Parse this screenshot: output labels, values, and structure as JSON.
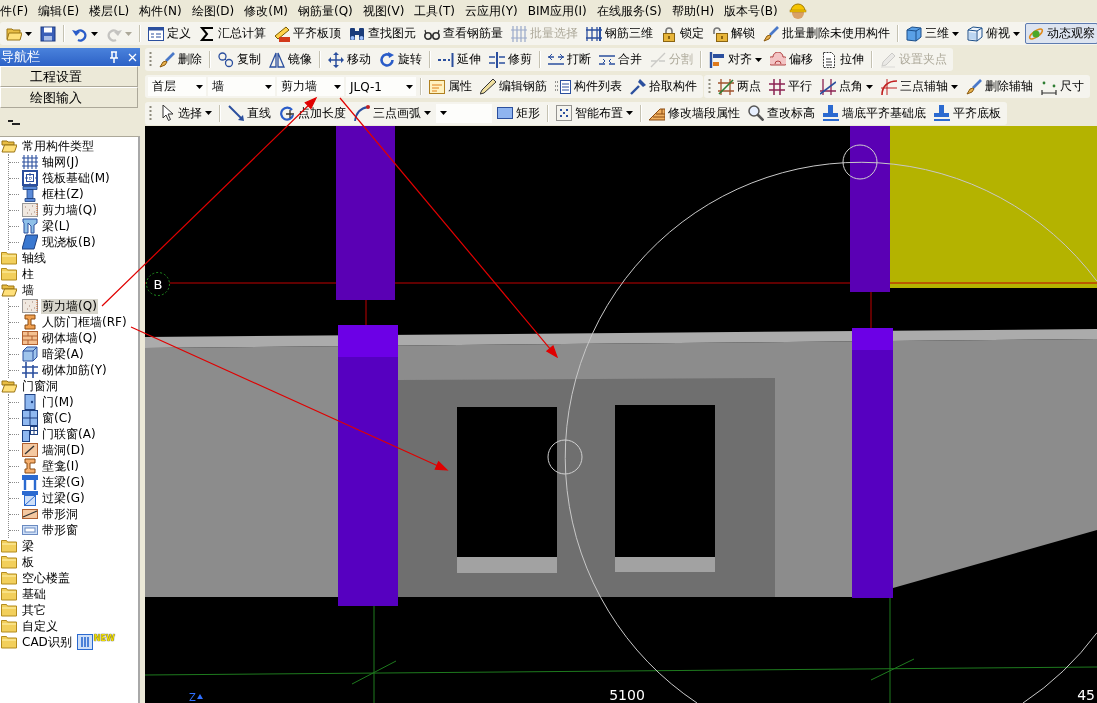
{
  "menu_bar": [
    "件(F)",
    "编辑(E)",
    "楼层(L)",
    "构件(N)",
    "绘图(D)",
    "修改(M)",
    "钢筋量(Q)",
    "视图(V)",
    "工具(T)",
    "云应用(Y)",
    "BIM应用(I)",
    "在线服务(S)",
    "帮助(H)",
    "版本号(B)"
  ],
  "main_toolbar": {
    "groups": [
      [
        {
          "kind": "icon-menu",
          "disabled": false
        },
        {
          "kind": "icon",
          "disabled": false
        }
      ],
      [
        {
          "kind": "icon-menu",
          "disabled": false
        },
        {
          "kind": "icon-menu",
          "disabled": true
        }
      ],
      [
        {
          "kind": "button",
          "label": "定义",
          "disabled": false
        },
        {
          "kind": "button",
          "label": "汇总计算",
          "disabled": false
        },
        {
          "kind": "button",
          "label": "平齐板顶",
          "disabled": false
        },
        {
          "kind": "button",
          "label": "查找图元",
          "disabled": false
        },
        {
          "kind": "button",
          "label": "查看钢筋量",
          "disabled": false
        },
        {
          "kind": "button",
          "label": "批量选择",
          "disabled": true
        },
        {
          "kind": "button",
          "label": "钢筋三维",
          "disabled": false
        },
        {
          "kind": "button",
          "label": "锁定",
          "disabled": false
        },
        {
          "kind": "button",
          "label": "解锁",
          "disabled": false
        },
        {
          "kind": "button",
          "label": "批量删除未使用构件",
          "disabled": false
        }
      ],
      [
        {
          "kind": "menu",
          "label": "三维",
          "disabled": false,
          "pressed": false
        },
        {
          "kind": "menu",
          "label": "俯视",
          "disabled": false,
          "pressed": false
        },
        {
          "kind": "button",
          "label": "动态观察",
          "disabled": false,
          "pressed": true
        }
      ]
    ]
  },
  "navigation": {
    "title": "导航栏",
    "sections": [
      "工程设置",
      "绘图输入"
    ],
    "tree": [
      {
        "label": "常用构件类型",
        "expanded": true,
        "children": [
          {
            "label": "轴网(J)",
            "selected": false
          },
          {
            "label": "筏板基础(M)",
            "selected": false
          },
          {
            "label": "框柱(Z)",
            "selected": false
          },
          {
            "label": "剪力墙(Q)",
            "selected": false
          },
          {
            "label": "梁(L)",
            "selected": false
          },
          {
            "label": "现浇板(B)",
            "selected": false
          }
        ]
      },
      {
        "label": "轴线",
        "expanded": false
      },
      {
        "label": "柱",
        "expanded": false
      },
      {
        "label": "墙",
        "expanded": true,
        "children": [
          {
            "label": "剪力墙(Q)",
            "selected": true
          },
          {
            "label": "人防门框墙(RF)",
            "selected": false
          },
          {
            "label": "砌体墙(Q)",
            "selected": false
          },
          {
            "label": "暗梁(A)",
            "selected": false
          },
          {
            "label": "砌体加筋(Y)",
            "selected": false
          }
        ]
      },
      {
        "label": "门窗洞",
        "expanded": true,
        "children": [
          {
            "label": "门(M)",
            "selected": false
          },
          {
            "label": "窗(C)",
            "selected": false
          },
          {
            "label": "门联窗(A)",
            "selected": false
          },
          {
            "label": "墙洞(D)",
            "selected": false
          },
          {
            "label": "壁龛(I)",
            "selected": false
          },
          {
            "label": "连梁(G)",
            "selected": false
          },
          {
            "label": "过梁(G)",
            "selected": false
          },
          {
            "label": "带形洞",
            "selected": false
          },
          {
            "label": "带形窗",
            "selected": false
          }
        ]
      },
      {
        "label": "梁",
        "expanded": false
      },
      {
        "label": "板",
        "expanded": false
      },
      {
        "label": "空心楼盖",
        "expanded": false
      },
      {
        "label": "基础",
        "expanded": false
      },
      {
        "label": "其它",
        "expanded": false
      },
      {
        "label": "自定义",
        "expanded": false
      },
      {
        "label": "CAD识别",
        "expanded": false,
        "badge": "NEW"
      }
    ]
  },
  "toolbar_rows": [
    [
      {
        "grip": true,
        "groups": [
          [
            {
              "kind": "button",
              "label": "删除",
              "disabled": false
            }
          ],
          [
            {
              "kind": "button",
              "label": "复制",
              "disabled": false
            },
            {
              "kind": "button",
              "label": "镜像",
              "disabled": false
            }
          ],
          [
            {
              "kind": "button",
              "label": "移动",
              "disabled": false
            },
            {
              "kind": "button",
              "label": "旋转",
              "disabled": false
            }
          ],
          [
            {
              "kind": "button",
              "label": "延伸",
              "disabled": false
            },
            {
              "kind": "button",
              "label": "修剪",
              "disabled": false
            }
          ],
          [
            {
              "kind": "button",
              "label": "打断",
              "disabled": false
            },
            {
              "kind": "button",
              "label": "合并",
              "disabled": false
            },
            {
              "kind": "button",
              "label": "分割",
              "disabled": true
            }
          ],
          [
            {
              "kind": "menu",
              "label": "对齐",
              "disabled": false
            },
            {
              "kind": "button",
              "label": "偏移",
              "disabled": false
            },
            {
              "kind": "button",
              "label": "拉伸",
              "disabled": false
            }
          ],
          [
            {
              "kind": "button",
              "label": "设置夹点",
              "disabled": true
            }
          ]
        ]
      }
    ],
    [
      {
        "grip": false,
        "groups": [
          [
            {
              "kind": "combo",
              "value": "首层",
              "disabled": false
            },
            {
              "kind": "combo",
              "value": "墙",
              "disabled": false
            },
            {
              "kind": "combo",
              "value": "剪力墙",
              "disabled": false
            },
            {
              "kind": "combo",
              "value": "JLQ-1",
              "disabled": false
            }
          ],
          [
            {
              "kind": "button",
              "label": "属性",
              "disabled": false
            },
            {
              "kind": "button",
              "label": "编辑钢筋",
              "disabled": false
            },
            {
              "kind": "button",
              "label": "构件列表",
              "disabled": false
            },
            {
              "kind": "button",
              "label": "拾取构件",
              "disabled": false
            }
          ]
        ]
      },
      {
        "grip": true,
        "groups": [
          [
            {
              "kind": "button",
              "label": "两点",
              "disabled": false
            },
            {
              "kind": "button",
              "label": "平行",
              "disabled": false
            },
            {
              "kind": "menu",
              "label": "点角",
              "disabled": false
            },
            {
              "kind": "menu",
              "label": "三点辅轴",
              "disabled": false
            },
            {
              "kind": "button",
              "label": "删除辅轴",
              "disabled": false
            },
            {
              "kind": "button",
              "label": "尺寸",
              "disabled": false
            }
          ]
        ]
      }
    ],
    [
      {
        "grip": true,
        "groups": [
          [
            {
              "kind": "menu",
              "label": "选择",
              "disabled": false
            }
          ],
          [
            {
              "kind": "button",
              "label": "直线",
              "disabled": false
            },
            {
              "kind": "button",
              "label": "点加长度",
              "disabled": false
            },
            {
              "kind": "menu",
              "label": "三点画弧",
              "disabled": false
            },
            {
              "kind": "combo",
              "disabled": false
            },
            {
              "kind": "button",
              "label": "矩形",
              "disabled": false
            }
          ],
          [
            {
              "kind": "menu",
              "label": "智能布置",
              "disabled": false
            }
          ],
          [
            {
              "kind": "button",
              "label": "修改墙段属性",
              "disabled": false
            },
            {
              "kind": "button",
              "label": "查改标高",
              "disabled": false
            },
            {
              "kind": "button",
              "label": "墙底平齐基础底",
              "disabled": false
            },
            {
              "kind": "button",
              "label": "平齐底板",
              "disabled": false
            }
          ]
        ]
      }
    ]
  ],
  "canvas": {
    "axis_label": "B",
    "dimension_labels": [
      "5100",
      "45"
    ],
    "z_axis_label": "Z"
  }
}
